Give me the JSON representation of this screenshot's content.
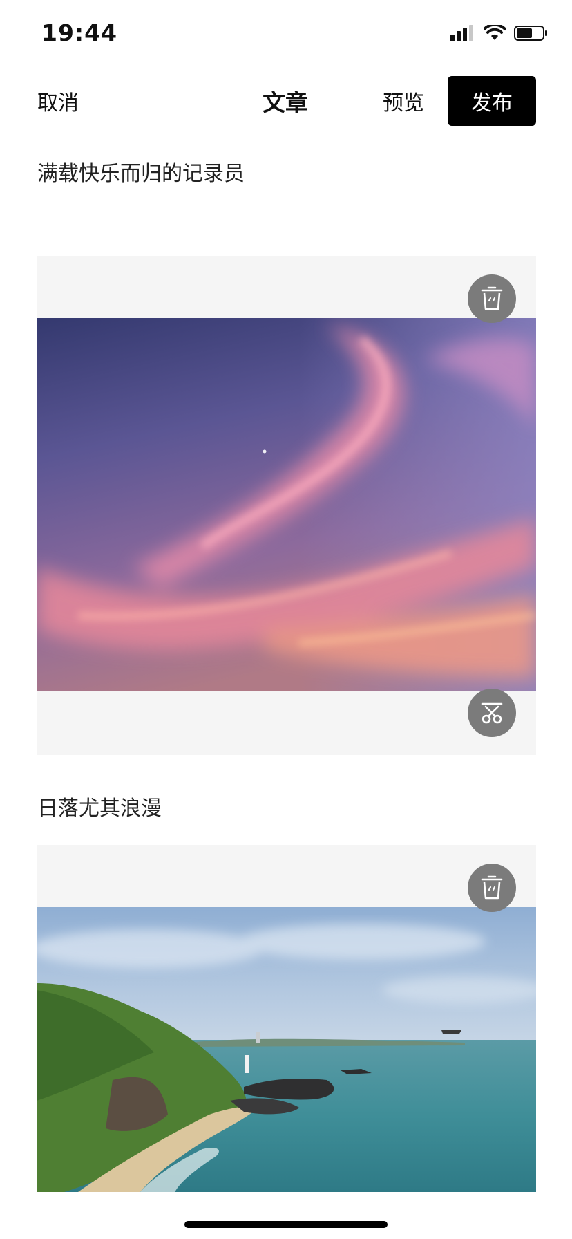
{
  "status_bar": {
    "time": "19:44",
    "battery_level": 0.62
  },
  "nav": {
    "cancel_label": "取消",
    "title": "文章",
    "preview_label": "预览",
    "publish_label": "发布"
  },
  "blocks": [
    {
      "caption": "满载快乐而归的记录员",
      "image_desc": "sunset-sky-photo"
    },
    {
      "caption": "日落尤其浪漫",
      "image_desc": "coastline-photo"
    }
  ],
  "icons": {
    "delete": "trash-icon",
    "crop": "scissors-icon",
    "signal": "cellular-signal-icon",
    "wifi": "wifi-icon",
    "battery": "battery-icon"
  },
  "colors": {
    "publish_bg": "#000000",
    "publish_text": "#ffffff",
    "card_bg": "#f5f5f5",
    "overlay_btn": "#7b7b7b"
  }
}
